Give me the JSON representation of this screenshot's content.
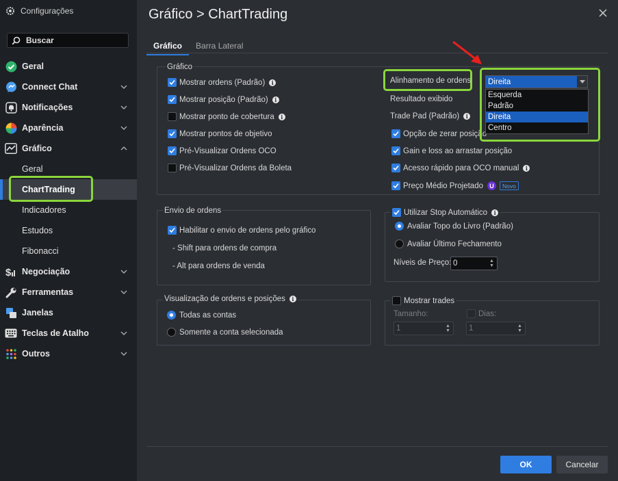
{
  "sidebar": {
    "header": "Configurações",
    "search_label": "Buscar",
    "items": [
      {
        "label": "Geral",
        "icon": "check-circle-icon"
      },
      {
        "label": "Connect Chat",
        "icon": "chat-icon"
      },
      {
        "label": "Notificações",
        "icon": "bell-icon"
      },
      {
        "label": "Aparência",
        "icon": "palette-icon"
      },
      {
        "label": "Gráfico",
        "icon": "chart-icon"
      },
      {
        "label": "Negociação",
        "icon": "dollar-icon"
      },
      {
        "label": "Ferramentas",
        "icon": "wrench-icon"
      },
      {
        "label": "Janelas",
        "icon": "windows-icon"
      },
      {
        "label": "Teclas de Atalho",
        "icon": "keyboard-icon"
      },
      {
        "label": "Outros",
        "icon": "dots-grid-icon"
      }
    ],
    "grafico_sub": [
      "Geral",
      "ChartTrading",
      "Indicadores",
      "Estudos",
      "Fibonacci"
    ]
  },
  "dialog": {
    "title": "Gráfico > ChartTrading",
    "tabs": [
      "Gráfico",
      "Barra Lateral"
    ]
  },
  "grafico_group": {
    "legend": "Gráfico",
    "left_options": [
      {
        "label": "Mostrar ordens (Padrão)",
        "checked": true
      },
      {
        "label": "Mostrar posição (Padrão)",
        "checked": true
      },
      {
        "label": "Mostrar ponto de cobertura",
        "checked": false
      },
      {
        "label": "Mostrar pontos de objetivo",
        "checked": true
      },
      {
        "label": "Pré-Visualizar Ordens OCO",
        "checked": true
      },
      {
        "label": "Pré-Visualizar Ordens da Boleta",
        "checked": false
      }
    ],
    "alignment_label": "Alinhamento de ordens",
    "alignment_value": "Direita",
    "alignment_options": [
      "Esquerda",
      "Padrão",
      "Direita",
      "Centro"
    ],
    "resultado_label": "Resultado exibido",
    "tradepad_label": "Trade Pad (Padrão)",
    "right_options": [
      {
        "label": "Opção de zerar posição",
        "checked": true
      },
      {
        "label": "Gain e loss ao arrastar posição",
        "checked": true
      },
      {
        "label": "Acesso rápido para OCO manual",
        "checked": true
      },
      {
        "label": "Preço Médio Projetado",
        "checked": true
      }
    ],
    "u_badge": "U",
    "novo_badge": "Novo"
  },
  "envio_group": {
    "legend": "Envio de ordens",
    "enable_label": "Habilitar o envio de ordens pelo gráfico",
    "shift_text": "- Shift para ordens de compra",
    "alt_text": "- Alt para ordens de venda"
  },
  "stop_group": {
    "legend": "Utilizar Stop Automático",
    "radio1": "Avaliar Topo do Livro (Padrão)",
    "radio2": "Avaliar Último Fechamento",
    "niveis_label": "Níveis de Preço:",
    "niveis_value": "0"
  },
  "visual_group": {
    "legend": "Visualização de ordens e posições",
    "radio1": "Todas as contas",
    "radio2": "Somente a conta selecionada"
  },
  "trades_group": {
    "legend": "Mostrar trades",
    "tamanho_label": "Tamanho:",
    "tamanho_value": "1",
    "dias_label": "Dias:",
    "dias_value": "1"
  },
  "buttons": {
    "ok": "OK",
    "cancel": "Cancelar"
  },
  "colors": {
    "accent": "#2f7de1",
    "highlight": "#8bd63c",
    "arrow": "#e8201e"
  }
}
